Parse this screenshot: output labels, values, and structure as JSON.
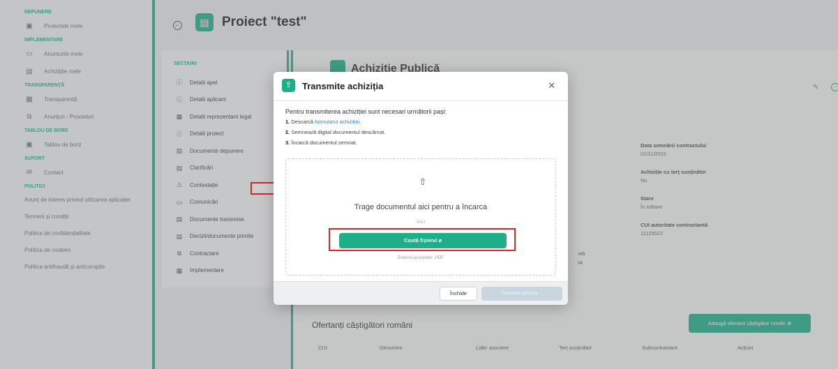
{
  "sidebar": {
    "groups": [
      {
        "heading": "DEPUNERE",
        "items": [
          {
            "icon": "document-plus-icon",
            "label": "Proiectele mele"
          }
        ]
      },
      {
        "heading": "IMPLEMENTARE",
        "items": [
          {
            "icon": "folder-icon",
            "label": "Anunțurile mele"
          },
          {
            "icon": "file-icon",
            "label": "Achizițiile mele"
          }
        ]
      },
      {
        "heading": "TRANSPARENȚĂ",
        "items": [
          {
            "icon": "table-icon",
            "label": "Transparență"
          },
          {
            "icon": "copy-icon",
            "label": "Anunțuri - Proceduri"
          }
        ]
      },
      {
        "heading": "TABLOU DE BORD",
        "items": [
          {
            "icon": "dashboard-icon",
            "label": "Tablou de bord"
          }
        ]
      },
      {
        "heading": "SUPORT",
        "items": [
          {
            "icon": "mail-icon",
            "label": "Contact"
          }
        ]
      },
      {
        "heading": "POLITICI",
        "items": []
      }
    ],
    "policies": [
      "Anunț de interes privind utilizarea aplicației",
      "Termeni și condiții",
      "Politica de confidențialitate",
      "Politica de cookies",
      "Politica antifraudă și anticorupție"
    ]
  },
  "header": {
    "title": "Proiect \"test\""
  },
  "sections": {
    "heading": "SECȚIUNI",
    "items": [
      {
        "icon": "info-icon",
        "label": "Detalii apel"
      },
      {
        "icon": "info-icon",
        "label": "Detalii aplicant"
      },
      {
        "icon": "id-card-icon",
        "label": "Detalii reprezentant legal"
      },
      {
        "icon": "info-icon",
        "label": "Detalii proiect"
      },
      {
        "icon": "file-icon",
        "label": "Documente depunere"
      },
      {
        "icon": "clipboard-icon",
        "label": "Clarificări"
      },
      {
        "icon": "warning-icon",
        "label": "Contestație"
      },
      {
        "icon": "chat-icon",
        "label": "Comunicări"
      },
      {
        "icon": "file-icon",
        "label": "Documente transmise"
      },
      {
        "icon": "file-icon",
        "label": "Decizii/documente primite"
      },
      {
        "icon": "copy-icon",
        "label": "Contractare"
      },
      {
        "icon": "table-icon",
        "label": "Implementare"
      }
    ]
  },
  "main": {
    "title": "Achiziție Publică",
    "info": [
      {
        "label": "Data semnării contractului",
        "value": "01/11/2022"
      },
      {
        "label": "Achiziție cu terț susținător",
        "value": "Nu"
      },
      {
        "label": "Stare",
        "value": "În editare"
      },
      {
        "label": "CUI autoritate contractantă",
        "value": "11125522"
      }
    ],
    "partial_1": "ntă",
    "partial_2": "IA",
    "winners_title": "Ofertanți câștigători români",
    "add_winner_label": "Adaugă ofertant câștigător român",
    "table_headers": [
      "CUI",
      "Denumire",
      "Lider asociere",
      "Terț susținător",
      "Subcontractant",
      "Acțiuni"
    ]
  },
  "modal": {
    "title": "Transmite achiziția",
    "intro": "Pentru transmiterea achiziției sunt necesari următorii pași:",
    "step1_num": "1.",
    "step1_text": "Descarcă",
    "step1_link": "formularul achiziției",
    "step1_end": ".",
    "step2_num": "2.",
    "step2_text": "Semnează digital documentul descărcat.",
    "step3_num": "3.",
    "step3_text": "Încarcă documentul semnat.",
    "dropzone_text": "Trage documentul aici pentru a încarca",
    "or_text": "SAU",
    "browse_label": "Caută fișierul",
    "accepted_ext": "Extensii acceptate: .PDF",
    "close_label": "Închide",
    "send_label": "Transmite achiziția"
  },
  "colors": {
    "accent": "#1fae8a",
    "annotation": "#d62828",
    "link": "#2f7fd6"
  }
}
